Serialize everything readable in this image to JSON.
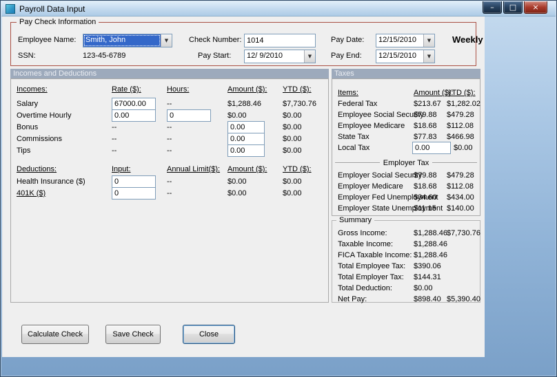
{
  "window": {
    "title": "Payroll Data Input",
    "minimize_glyph": "–",
    "maximize_glyph": "□",
    "close_glyph": "×"
  },
  "colors": {
    "selection": "#3468C9",
    "group_border": "#A94F42",
    "band_bg": "#9DAABC",
    "band_text": "#EBEEF3",
    "client_bg": "#EFEFEF"
  },
  "paycheck": {
    "legend": "Pay Check Information",
    "employee_name": {
      "label": "Employee Name:",
      "value": "Smith, John"
    },
    "ssn": {
      "label": "SSN:",
      "value": "123-45-6789"
    },
    "check_number": {
      "label": "Check Number:",
      "value": "1014"
    },
    "pay_start": {
      "label": "Pay Start:",
      "value": "12/ 9/2010"
    },
    "pay_date": {
      "label": "Pay Date:",
      "value": "12/15/2010"
    },
    "pay_end": {
      "label": "Pay End:",
      "value": "12/15/2010"
    },
    "frequency": "Weekly"
  },
  "sections": {
    "incomes_header": "Incomes and Deductions",
    "taxes_header": "Taxes"
  },
  "incomes": {
    "headers": {
      "name": "Incomes:",
      "rate": "Rate ($):",
      "hours": "Hours:",
      "amount": "Amount ($):",
      "ytd": "YTD ($):"
    },
    "salary": {
      "label": "Salary",
      "rate": "67000.00",
      "hours": "--",
      "amount": "$1,288.46",
      "ytd": "$7,730.76"
    },
    "overtime": {
      "label": "Overtime Hourly",
      "rate": "0.00",
      "hours": "0",
      "amount": "$0.00",
      "ytd": "$0.00"
    },
    "bonus": {
      "label": "Bonus",
      "rate": "--",
      "hours": "--",
      "amount": "0.00",
      "ytd": "$0.00"
    },
    "commissions": {
      "label": "Commissions",
      "rate": "--",
      "hours": "--",
      "amount": "0.00",
      "ytd": "$0.00"
    },
    "tips": {
      "label": "Tips",
      "rate": "--",
      "hours": "--",
      "amount": "0.00",
      "ytd": "$0.00"
    }
  },
  "deductions": {
    "headers": {
      "name": "Deductions:",
      "input": "Input:",
      "limit": "Annual Limit($):",
      "amount": "Amount ($):",
      "ytd": "YTD ($):"
    },
    "health": {
      "label": "Health Insurance  ($)",
      "input": "0",
      "limit": "--",
      "amount": "$0.00",
      "ytd": "$0.00"
    },
    "k401": {
      "label": "401K  ($)",
      "input": "0",
      "limit": "--",
      "amount": "$0.00",
      "ytd": "$0.00"
    }
  },
  "taxes": {
    "headers": {
      "items": "Items:",
      "amount": "Amount ($):",
      "ytd": "YTD ($):"
    },
    "federal": {
      "label": "Federal Tax",
      "amount": "$213.67",
      "ytd": "$1,282.02"
    },
    "emp_ss": {
      "label": "Employee Social Security",
      "amount": "$79.88",
      "ytd": "$479.28"
    },
    "emp_medicare": {
      "label": "Employee Medicare",
      "amount": "$18.68",
      "ytd": "$112.08"
    },
    "state": {
      "label": "State Tax",
      "amount": "$77.83",
      "ytd": "$466.98"
    },
    "local": {
      "label": "Local Tax",
      "amount": "0.00",
      "ytd": "$0.00"
    },
    "employer_divider": "Employer Tax",
    "er_ss": {
      "label": "Employer Social Security",
      "amount": "$79.88",
      "ytd": "$479.28"
    },
    "er_medicare": {
      "label": "Employer Medicare",
      "amount": "$18.68",
      "ytd": "$112.08"
    },
    "er_fed_unemp": {
      "label": "Employer Fed Unemployment",
      "amount": "$34.60",
      "ytd": "$434.00"
    },
    "er_state_unemp": {
      "label": "Employer State Unemployment",
      "amount": "$11.15",
      "ytd": "$140.00"
    }
  },
  "summary": {
    "legend": "Summary",
    "gross": {
      "label": "Gross Income:",
      "amount": "$1,288.46",
      "ytd": "$7,730.76"
    },
    "taxable": {
      "label": "Taxable Income:",
      "amount": "$1,288.46"
    },
    "fica": {
      "label": "FICA Taxable Income:",
      "amount": "$1,288.46"
    },
    "total_employee_tax": {
      "label": "Total Employee Tax:",
      "amount": "$390.06"
    },
    "total_employer_tax": {
      "label": "Total Employer Tax:",
      "amount": "$144.31"
    },
    "total_deduction": {
      "label": "Total Deduction:",
      "amount": "$0.00"
    },
    "net_pay": {
      "label": "Net Pay:",
      "amount": "$898.40",
      "ytd": "$5,390.40"
    }
  },
  "buttons": {
    "calculate": "Calculate Check",
    "save": "Save Check",
    "close": "Close"
  }
}
